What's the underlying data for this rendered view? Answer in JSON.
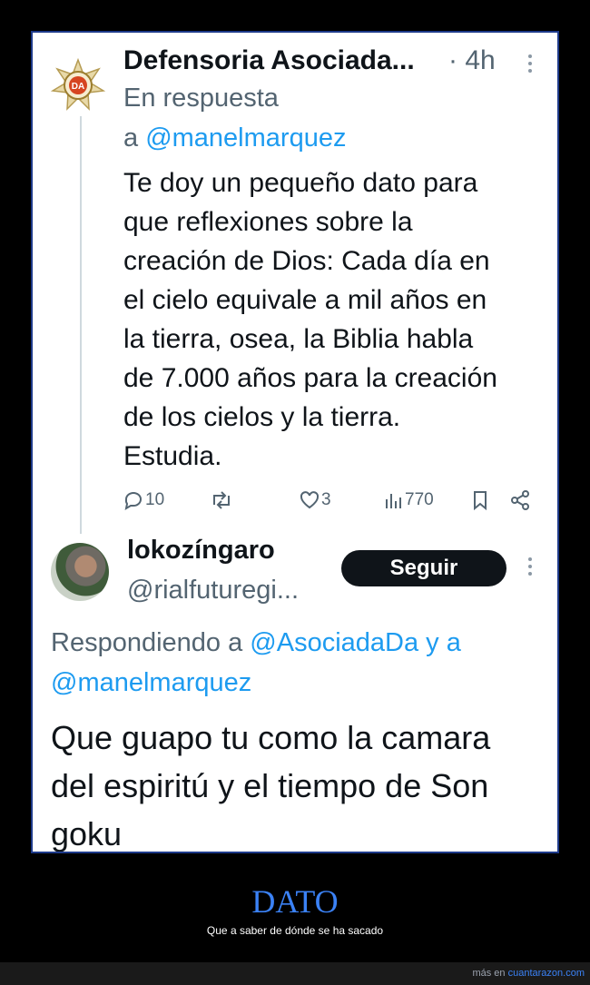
{
  "tweet": {
    "author": "Defensoria Asociada...",
    "time": "· 4h",
    "reply_prefix": "En respuesta",
    "reply_to_a": "a",
    "reply_to_handle": "@manelmarquez",
    "text_lines": [
      "Te doy un pequeño dato para",
      "que reflexiones sobre la",
      "creación de Dios: Cada día en",
      "el cielo equivale a mil años en",
      "la tierra, osea, la Biblia habla",
      "de 7.000 años para la creación",
      "de los cielos y la tierra.",
      "Estudia."
    ],
    "logo_text": "DA",
    "replies": "10",
    "likes": "3",
    "views": "770"
  },
  "reply": {
    "author": "lokozíngaro",
    "handle": "@rialfuturegi...",
    "follow_label": "Seguir",
    "responding_prefix": "Respondiendo a",
    "responding_handle1": "@AsociadaDa",
    "responding_joiner": "y a",
    "responding_handle2": "@manelmarquez",
    "text_lines": [
      "Que guapo tu como la camara",
      "del espiritú y el tiempo de Son",
      "goku"
    ]
  },
  "caption": {
    "title": "DATO",
    "subtitle": "Que a saber de dónde se ha sacado"
  },
  "footer": {
    "prefix": "más en",
    "site": "cuantarazon.com"
  }
}
